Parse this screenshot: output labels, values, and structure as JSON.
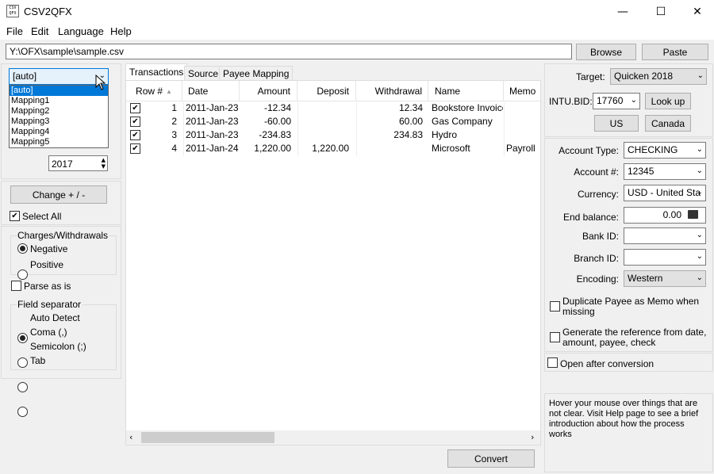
{
  "window": {
    "title": "CSV2QFX",
    "icon_text": "CSV\nQFX",
    "minimize": "—",
    "maximize": "☐",
    "close": "✕"
  },
  "menu": [
    "File",
    "Edit",
    "Language",
    "Help"
  ],
  "path": {
    "value": "Y:\\OFX\\sample\\sample.csv",
    "browse_label": "Browse",
    "paste_label": "Paste"
  },
  "left": {
    "mapping": {
      "selected": "[auto]",
      "options": [
        "[auto]",
        "Mapping1",
        "Mapping2",
        "Mapping3",
        "Mapping4",
        "Mapping5"
      ]
    },
    "year": "2017",
    "change_label": "Change + / -",
    "select_all_label": "Select All",
    "select_all_checked": true,
    "charges": {
      "title": "Charges/Withdrawals",
      "options": [
        "Negative",
        "Positive"
      ],
      "selected": "Negative"
    },
    "parse_as_is_label": "Parse as is",
    "separator": {
      "title": "Field separator",
      "options": [
        "Auto Detect",
        "Coma (,)",
        "Semicolon (;)",
        "Tab"
      ],
      "selected": "Auto Detect"
    }
  },
  "tabs": [
    "Transactions",
    "Source",
    "Payee Mapping"
  ],
  "table": {
    "columns": [
      "Row #",
      "Date",
      "Amount",
      "Deposit",
      "Withdrawal",
      "Name",
      "Memo"
    ],
    "rows": [
      {
        "row": "1",
        "date": "2011-Jan-23",
        "amount": "-12.34",
        "deposit": "",
        "withdrawal": "12.34",
        "name": "Bookstore Invoice",
        "memo": ""
      },
      {
        "row": "2",
        "date": "2011-Jan-23",
        "amount": "-60.00",
        "deposit": "",
        "withdrawal": "60.00",
        "name": "Gas Company",
        "memo": ""
      },
      {
        "row": "3",
        "date": "2011-Jan-23",
        "amount": "-234.83",
        "deposit": "",
        "withdrawal": "234.83",
        "name": "Hydro",
        "memo": ""
      },
      {
        "row": "4",
        "date": "2011-Jan-24",
        "amount": "1,220.00",
        "deposit": "1,220.00",
        "withdrawal": "",
        "name": "Microsoft",
        "memo": "Payroll"
      }
    ]
  },
  "convert_label": "Convert",
  "right": {
    "target_label": "Target:",
    "target_value": "Quicken 2018",
    "intu_label": "INTU.BID:",
    "intu_value": "17760",
    "lookup_label": "Look up",
    "us_label": "US",
    "canada_label": "Canada",
    "account_type_label": "Account Type:",
    "account_type_value": "CHECKING",
    "account_num_label": "Account #:",
    "account_num_value": "12345",
    "currency_label": "Currency:",
    "currency_value": "USD - United Sta",
    "end_balance_label": "End balance:",
    "end_balance_value": "0.00",
    "bank_id_label": "Bank ID:",
    "bank_id_value": "",
    "branch_id_label": "Branch ID:",
    "branch_id_value": "",
    "encoding_label": "Encoding:",
    "encoding_value": "Western",
    "dup_payee_label_1": "Duplicate Payee as Memo when",
    "dup_payee_label_2": "missing",
    "gen_ref_label_1": "Generate the reference from date,",
    "gen_ref_label_2": "amount, payee, check",
    "open_after_label": "Open after conversion",
    "help_text": "Hover your mouse over things that are not clear. Visit Help page to see a brief introduction about how the process works"
  }
}
